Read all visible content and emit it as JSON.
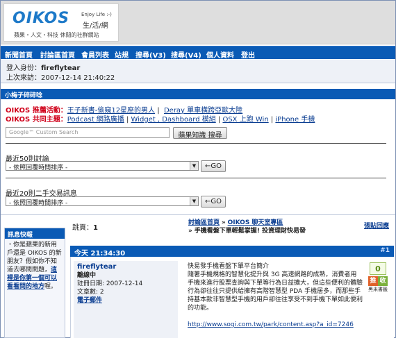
{
  "header": {
    "logo_text": "OIKOS",
    "logo_tagline": "Enjoy Life :-)",
    "logo_cn": "生/活/網",
    "logo_sub": "蘋果・人文・科技  休閒的社群網站"
  },
  "nav": [
    "新聞首頁",
    "討論區首頁",
    "會員列表",
    "站規",
    "搜尋(V3)",
    "搜尋(V4)",
    "個人資料",
    "登出"
  ],
  "login": {
    "identity_label": "登入身份：",
    "identity_value": "fireflytear",
    "last_visit_label": "上次來訪：",
    "last_visit_value": "2007-12-14 21:40:22"
  },
  "section_title": "小梅子碎碎唸",
  "promos": [
    {
      "label": "OIKOS 推薦活動：",
      "links": [
        "王子新書-偷窺12星座的男人",
        "Deray 單車橫跨亞歐大陸"
      ]
    },
    {
      "label": "OIKOS 共同主題：",
      "links": [
        "Podcast 網路廣播",
        "Widget , Dashboard 模組",
        "OSX 上跑 Win",
        "iPhone 手機"
      ]
    }
  ],
  "search": {
    "placeholder": "Google™ Custom Search",
    "button": "蘋果知識 搜尋"
  },
  "recent_topics": {
    "label": "最近50則討論",
    "select_value": "- 依照回覆時間排序 -",
    "go_label": "←GO"
  },
  "recent_trade": {
    "label": "最近20則二手交易訊息",
    "select_value": "- 依照回覆時間排序 -",
    "go_label": "←GO"
  },
  "sidebox": {
    "title": "訊息快報",
    "text": "・你是蘋果的新用戶還是 OIKOS 的新朋友？假如你不知道去哪問問題，",
    "link": "這裡是你第一個可以看看問的地方",
    "tail": "喔。"
  },
  "thread": {
    "page_label": "跳頁：",
    "page_value": "1",
    "crumb_1": "討論區首頁",
    "crumb_2": "OIKOS 聊天室專區",
    "crumb_3": "手機看盤下單輕鬆掌握! 投資理財快易發",
    "sep": "»",
    "reply_label": "張貼回應"
  },
  "post": {
    "time": "今天 21:34:30",
    "number": "#1",
    "author": "fireflytear",
    "author_status": "離線中",
    "reg_date": "註冊日期: 2007-12-14",
    "post_count": "文章數: 2",
    "email": "電子郵件",
    "content_title": "快易發手機看盤下單平台簡介",
    "content": "隨著手機規格的智慧化提升與 3G 高速網路的成熟，消費者用手機來進行股票查詢與下單等行為日益擴大，但這些便利的體驗行為卻往往只提供給擁有高階智慧型 PDA 手機居多，而那些手持基本款非智慧型手機的用戶卻往往享受不到手機下單如此便利的功能。",
    "link": "http://www.sogi.com.tw/park/content.asp?a_id=7246",
    "vote_count": "0",
    "vote_push": "推",
    "vote_save": "收",
    "vote_note": "黑米書籤"
  }
}
